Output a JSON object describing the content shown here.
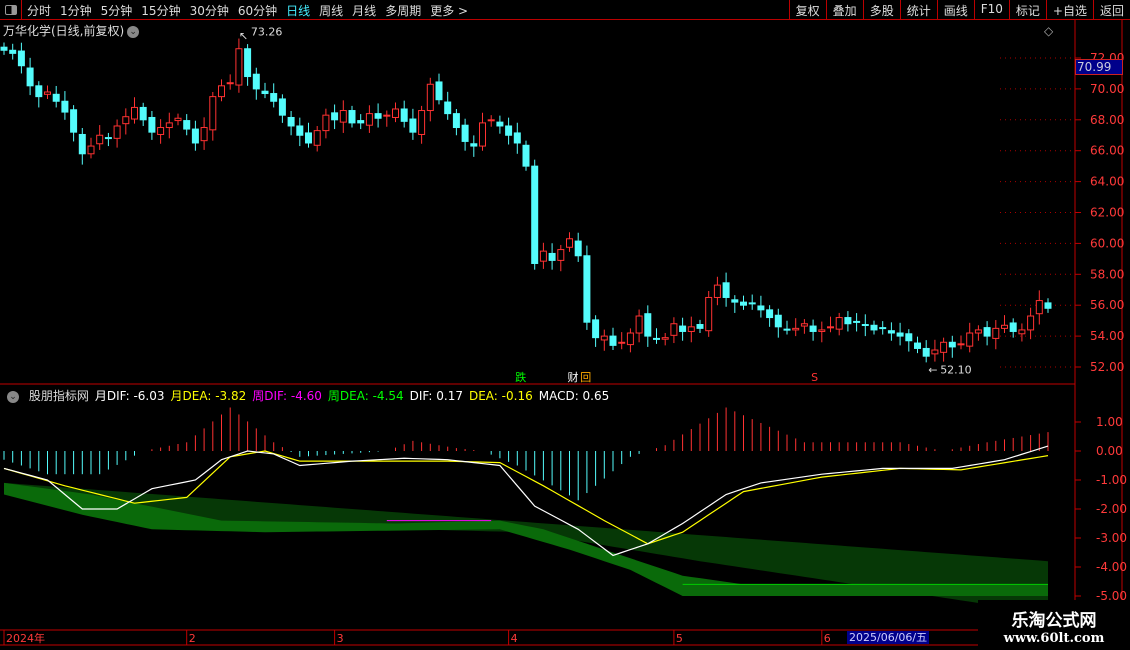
{
  "toolbar": {
    "periods": [
      "分时",
      "1分钟",
      "5分钟",
      "15分钟",
      "30分钟",
      "60分钟",
      "日线",
      "周线",
      "月线",
      "多周期",
      "更多 >"
    ],
    "active_period": "日线",
    "buttons": [
      "复权",
      "叠加",
      "多股",
      "统计",
      "画线",
      "F10",
      "标记",
      "+自选",
      "返回"
    ]
  },
  "title": "万华化学(日线,前复权)",
  "current_price": "70.99",
  "annotations": {
    "high": "73.26",
    "low": "52.10",
    "marks": [
      "跌",
      "财",
      "回",
      "S"
    ]
  },
  "indicator": {
    "name": "股朋指标网",
    "values": [
      {
        "label": "月DIF: -6.03",
        "color": "#ffffff"
      },
      {
        "label": "月DEA: -3.82",
        "color": "#ffff00"
      },
      {
        "label": "周DIF: -4.60",
        "color": "#ff00ff"
      },
      {
        "label": "周DEA: -4.54",
        "color": "#00ff00"
      },
      {
        "label": "DIF: 0.17",
        "color": "#ffffff"
      },
      {
        "label": "DEA: -0.16",
        "color": "#ffff00"
      },
      {
        "label": "MACD: 0.65",
        "color": "#ffffff"
      }
    ]
  },
  "xaxis": {
    "labels": [
      "2024年",
      "2",
      "3",
      "4",
      "5",
      "6"
    ],
    "label_index": [
      0,
      21,
      38,
      58,
      77,
      94
    ],
    "cursor_date": "2025/06/06/五"
  },
  "watermark": {
    "line1": "乐淘公式网",
    "line2": "www.60lt.com"
  },
  "chart_data": {
    "type": "candlestick",
    "price_ticks": [
      "72.00",
      "70.00",
      "68.00",
      "66.00",
      "64.00",
      "62.00",
      "60.00",
      "58.00",
      "56.00",
      "54.00",
      "52.00"
    ],
    "ylim": [
      51.5,
      73.5
    ],
    "closes": [
      72.5,
      72.3,
      71.5,
      70.2,
      69.5,
      69.8,
      69.2,
      68.5,
      67.2,
      65.8,
      66.3,
      67.0,
      66.8,
      67.6,
      68.2,
      68.8,
      68.0,
      67.2,
      67.5,
      67.8,
      68.1,
      67.4,
      66.5,
      67.5,
      69.5,
      70.2,
      70.4,
      72.6,
      70.8,
      70.0,
      69.7,
      69.2,
      68.3,
      67.6,
      67.0,
      66.5,
      67.3,
      68.3,
      68.0,
      68.6,
      67.8,
      67.8,
      68.4,
      68.1,
      68.3,
      68.7,
      67.9,
      67.2,
      68.6,
      70.3,
      69.3,
      68.4,
      67.5,
      66.6,
      66.3,
      67.8,
      68.0,
      67.6,
      67.0,
      66.5,
      65.0,
      58.7,
      59.5,
      58.9,
      59.6,
      60.3,
      59.2,
      54.9,
      53.9,
      54.0,
      53.4,
      53.6,
      54.2,
      55.3,
      54.0,
      53.8,
      53.9,
      54.8,
      54.3,
      54.6,
      54.5,
      56.5,
      57.3,
      56.5,
      56.2,
      56.0,
      56.1,
      55.7,
      55.2,
      54.6,
      54.4,
      54.5,
      54.8,
      54.3,
      54.4,
      54.6,
      55.2,
      54.8,
      54.9,
      54.7,
      54.4,
      54.5,
      54.2,
      54.0,
      53.7,
      53.2,
      52.7,
      53.1,
      53.6,
      53.3,
      53.5,
      54.2,
      54.4,
      54.0,
      54.5,
      54.7,
      54.3,
      54.4,
      55.3,
      56.3,
      55.8
    ],
    "macd": {
      "ticks": [
        "1.00",
        "0.00",
        "-1.00",
        "-2.00",
        "-3.00",
        "-4.00",
        "-5.00"
      ],
      "ylim": [
        -5,
        1.6
      ],
      "dif": [
        [
          0,
          -0.6
        ],
        [
          5,
          -1.0
        ],
        [
          9,
          -2.0
        ],
        [
          13,
          -2.0
        ],
        [
          17,
          -1.3
        ],
        [
          22,
          -1.0
        ],
        [
          25,
          -0.3
        ],
        [
          28,
          0.0
        ],
        [
          31,
          -0.1
        ],
        [
          34,
          -0.5
        ],
        [
          40,
          -0.35
        ],
        [
          46,
          -0.25
        ],
        [
          51,
          -0.3
        ],
        [
          57,
          -0.5
        ],
        [
          61,
          -1.9
        ],
        [
          66,
          -2.7
        ],
        [
          70,
          -3.6
        ],
        [
          74,
          -3.2
        ],
        [
          78,
          -2.5
        ],
        [
          83,
          -1.5
        ],
        [
          87,
          -1.1
        ],
        [
          94,
          -0.8
        ],
        [
          101,
          -0.6
        ],
        [
          109,
          -0.6
        ],
        [
          115,
          -0.3
        ],
        [
          120,
          0.17
        ]
      ],
      "dea": [
        [
          0,
          -0.6
        ],
        [
          7,
          -1.2
        ],
        [
          15,
          -1.8
        ],
        [
          21,
          -1.6
        ],
        [
          26,
          -0.2
        ],
        [
          30,
          0.0
        ],
        [
          34,
          -0.35
        ],
        [
          46,
          -0.35
        ],
        [
          51,
          -0.35
        ],
        [
          57,
          -0.4
        ],
        [
          62,
          -1.2
        ],
        [
          69,
          -2.4
        ],
        [
          74,
          -3.2
        ],
        [
          78,
          -2.8
        ],
        [
          85,
          -1.4
        ],
        [
          94,
          -0.9
        ],
        [
          103,
          -0.6
        ],
        [
          110,
          -0.65
        ],
        [
          120,
          -0.16
        ]
      ],
      "hist": [
        [
          0,
          -0.3
        ],
        [
          5,
          -0.8
        ],
        [
          11,
          -0.8
        ],
        [
          16,
          0
        ],
        [
          21,
          0.3
        ],
        [
          26,
          1.5
        ],
        [
          31,
          0.3
        ],
        [
          34,
          -0.2
        ],
        [
          44,
          0
        ],
        [
          47,
          0.35
        ],
        [
          52,
          0.1
        ],
        [
          55,
          0
        ],
        [
          59,
          -0.5
        ],
        [
          66,
          -1.7
        ],
        [
          72,
          -0.2
        ],
        [
          76,
          0.2
        ],
        [
          83,
          1.5
        ],
        [
          89,
          0.7
        ],
        [
          92,
          0.3
        ],
        [
          103,
          0.3
        ],
        [
          108,
          0
        ],
        [
          113,
          0.3
        ],
        [
          120,
          0.65
        ]
      ],
      "weekly_band": {
        "upper": [
          [
            0,
            -1.1
          ],
          [
            10,
            -1.5
          ],
          [
            25,
            -2.4
          ],
          [
            45,
            -2.5
          ],
          [
            57,
            -2.4
          ],
          [
            62,
            -2.7
          ],
          [
            70,
            -3.5
          ],
          [
            78,
            -4.3
          ],
          [
            85,
            -4.6
          ],
          [
            120,
            -4.6
          ]
        ],
        "lower": [
          [
            0,
            -1.5
          ],
          [
            9,
            -2.2
          ],
          [
            17,
            -2.7
          ],
          [
            30,
            -2.8
          ],
          [
            57,
            -2.7
          ],
          [
            65,
            -3.4
          ],
          [
            72,
            -4.1
          ],
          [
            78,
            -5.0
          ],
          [
            120,
            -5.0
          ]
        ]
      },
      "monthly_band": {
        "upper": [
          [
            0,
            -1.1
          ],
          [
            120,
            -3.8
          ]
        ],
        "lower": [
          [
            0,
            -1.2
          ],
          [
            20,
            -2.5
          ],
          [
            60,
            -2.8
          ],
          [
            80,
            -3.8
          ],
          [
            100,
            -4.7
          ],
          [
            120,
            -5.6
          ]
        ]
      }
    }
  },
  "colors": {
    "up": "#ff3232",
    "down": "#54fcfc",
    "axis": "#c00000",
    "band_bright": "#0a6a0a",
    "band_dark": "#063806"
  }
}
